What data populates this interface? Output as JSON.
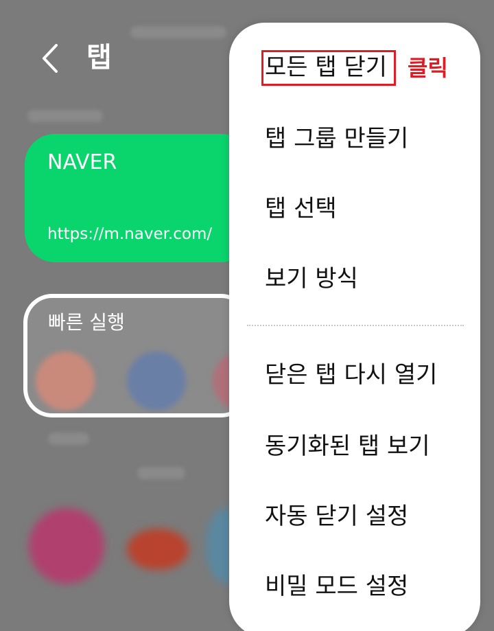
{
  "header": {
    "title": "탭",
    "back_icon": "chevron-left-icon"
  },
  "tab_card": {
    "title": "NAVER",
    "url": "https://m.naver.com/",
    "color": "#0ad46c"
  },
  "quick_access": {
    "title": "빠른 실행"
  },
  "menu": {
    "items": [
      {
        "label": "모든 탭 닫기"
      },
      {
        "label": "탭 그룹 만들기"
      },
      {
        "label": "탭 선택"
      },
      {
        "label": "보기 방식"
      },
      {
        "label": "닫은 탭 다시 열기"
      },
      {
        "label": "동기화된 탭 보기"
      },
      {
        "label": "자동 닫기 설정"
      },
      {
        "label": "비밀 모드 설정"
      }
    ]
  },
  "annotation": {
    "label": "클릭",
    "color": "#e01b24"
  }
}
